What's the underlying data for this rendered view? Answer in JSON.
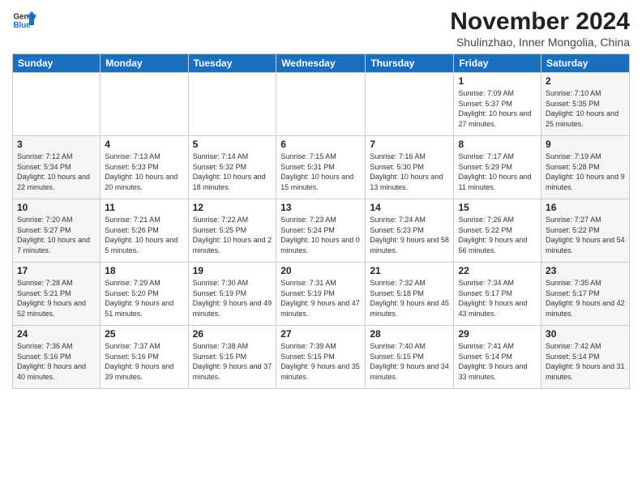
{
  "header": {
    "logo_general": "General",
    "logo_blue": "Blue",
    "month_year": "November 2024",
    "location": "Shulinzhao, Inner Mongolia, China"
  },
  "days_of_week": [
    "Sunday",
    "Monday",
    "Tuesday",
    "Wednesday",
    "Thursday",
    "Friday",
    "Saturday"
  ],
  "weeks": [
    [
      {
        "day": "",
        "info": ""
      },
      {
        "day": "",
        "info": ""
      },
      {
        "day": "",
        "info": ""
      },
      {
        "day": "",
        "info": ""
      },
      {
        "day": "",
        "info": ""
      },
      {
        "day": "1",
        "info": "Sunrise: 7:09 AM\nSunset: 5:37 PM\nDaylight: 10 hours and 27 minutes."
      },
      {
        "day": "2",
        "info": "Sunrise: 7:10 AM\nSunset: 5:35 PM\nDaylight: 10 hours and 25 minutes."
      }
    ],
    [
      {
        "day": "3",
        "info": "Sunrise: 7:12 AM\nSunset: 5:34 PM\nDaylight: 10 hours and 22 minutes."
      },
      {
        "day": "4",
        "info": "Sunrise: 7:13 AM\nSunset: 5:33 PM\nDaylight: 10 hours and 20 minutes."
      },
      {
        "day": "5",
        "info": "Sunrise: 7:14 AM\nSunset: 5:32 PM\nDaylight: 10 hours and 18 minutes."
      },
      {
        "day": "6",
        "info": "Sunrise: 7:15 AM\nSunset: 5:31 PM\nDaylight: 10 hours and 15 minutes."
      },
      {
        "day": "7",
        "info": "Sunrise: 7:16 AM\nSunset: 5:30 PM\nDaylight: 10 hours and 13 minutes."
      },
      {
        "day": "8",
        "info": "Sunrise: 7:17 AM\nSunset: 5:29 PM\nDaylight: 10 hours and 11 minutes."
      },
      {
        "day": "9",
        "info": "Sunrise: 7:19 AM\nSunset: 5:28 PM\nDaylight: 10 hours and 9 minutes."
      }
    ],
    [
      {
        "day": "10",
        "info": "Sunrise: 7:20 AM\nSunset: 5:27 PM\nDaylight: 10 hours and 7 minutes."
      },
      {
        "day": "11",
        "info": "Sunrise: 7:21 AM\nSunset: 5:26 PM\nDaylight: 10 hours and 5 minutes."
      },
      {
        "day": "12",
        "info": "Sunrise: 7:22 AM\nSunset: 5:25 PM\nDaylight: 10 hours and 2 minutes."
      },
      {
        "day": "13",
        "info": "Sunrise: 7:23 AM\nSunset: 5:24 PM\nDaylight: 10 hours and 0 minutes."
      },
      {
        "day": "14",
        "info": "Sunrise: 7:24 AM\nSunset: 5:23 PM\nDaylight: 9 hours and 58 minutes."
      },
      {
        "day": "15",
        "info": "Sunrise: 7:26 AM\nSunset: 5:22 PM\nDaylight: 9 hours and 56 minutes."
      },
      {
        "day": "16",
        "info": "Sunrise: 7:27 AM\nSunset: 5:22 PM\nDaylight: 9 hours and 54 minutes."
      }
    ],
    [
      {
        "day": "17",
        "info": "Sunrise: 7:28 AM\nSunset: 5:21 PM\nDaylight: 9 hours and 52 minutes."
      },
      {
        "day": "18",
        "info": "Sunrise: 7:29 AM\nSunset: 5:20 PM\nDaylight: 9 hours and 51 minutes."
      },
      {
        "day": "19",
        "info": "Sunrise: 7:30 AM\nSunset: 5:19 PM\nDaylight: 9 hours and 49 minutes."
      },
      {
        "day": "20",
        "info": "Sunrise: 7:31 AM\nSunset: 5:19 PM\nDaylight: 9 hours and 47 minutes."
      },
      {
        "day": "21",
        "info": "Sunrise: 7:32 AM\nSunset: 5:18 PM\nDaylight: 9 hours and 45 minutes."
      },
      {
        "day": "22",
        "info": "Sunrise: 7:34 AM\nSunset: 5:17 PM\nDaylight: 9 hours and 43 minutes."
      },
      {
        "day": "23",
        "info": "Sunrise: 7:35 AM\nSunset: 5:17 PM\nDaylight: 9 hours and 42 minutes."
      }
    ],
    [
      {
        "day": "24",
        "info": "Sunrise: 7:36 AM\nSunset: 5:16 PM\nDaylight: 9 hours and 40 minutes."
      },
      {
        "day": "25",
        "info": "Sunrise: 7:37 AM\nSunset: 5:16 PM\nDaylight: 9 hours and 39 minutes."
      },
      {
        "day": "26",
        "info": "Sunrise: 7:38 AM\nSunset: 5:15 PM\nDaylight: 9 hours and 37 minutes."
      },
      {
        "day": "27",
        "info": "Sunrise: 7:39 AM\nSunset: 5:15 PM\nDaylight: 9 hours and 35 minutes."
      },
      {
        "day": "28",
        "info": "Sunrise: 7:40 AM\nSunset: 5:15 PM\nDaylight: 9 hours and 34 minutes."
      },
      {
        "day": "29",
        "info": "Sunrise: 7:41 AM\nSunset: 5:14 PM\nDaylight: 9 hours and 33 minutes."
      },
      {
        "day": "30",
        "info": "Sunrise: 7:42 AM\nSunset: 5:14 PM\nDaylight: 9 hours and 31 minutes."
      }
    ]
  ]
}
